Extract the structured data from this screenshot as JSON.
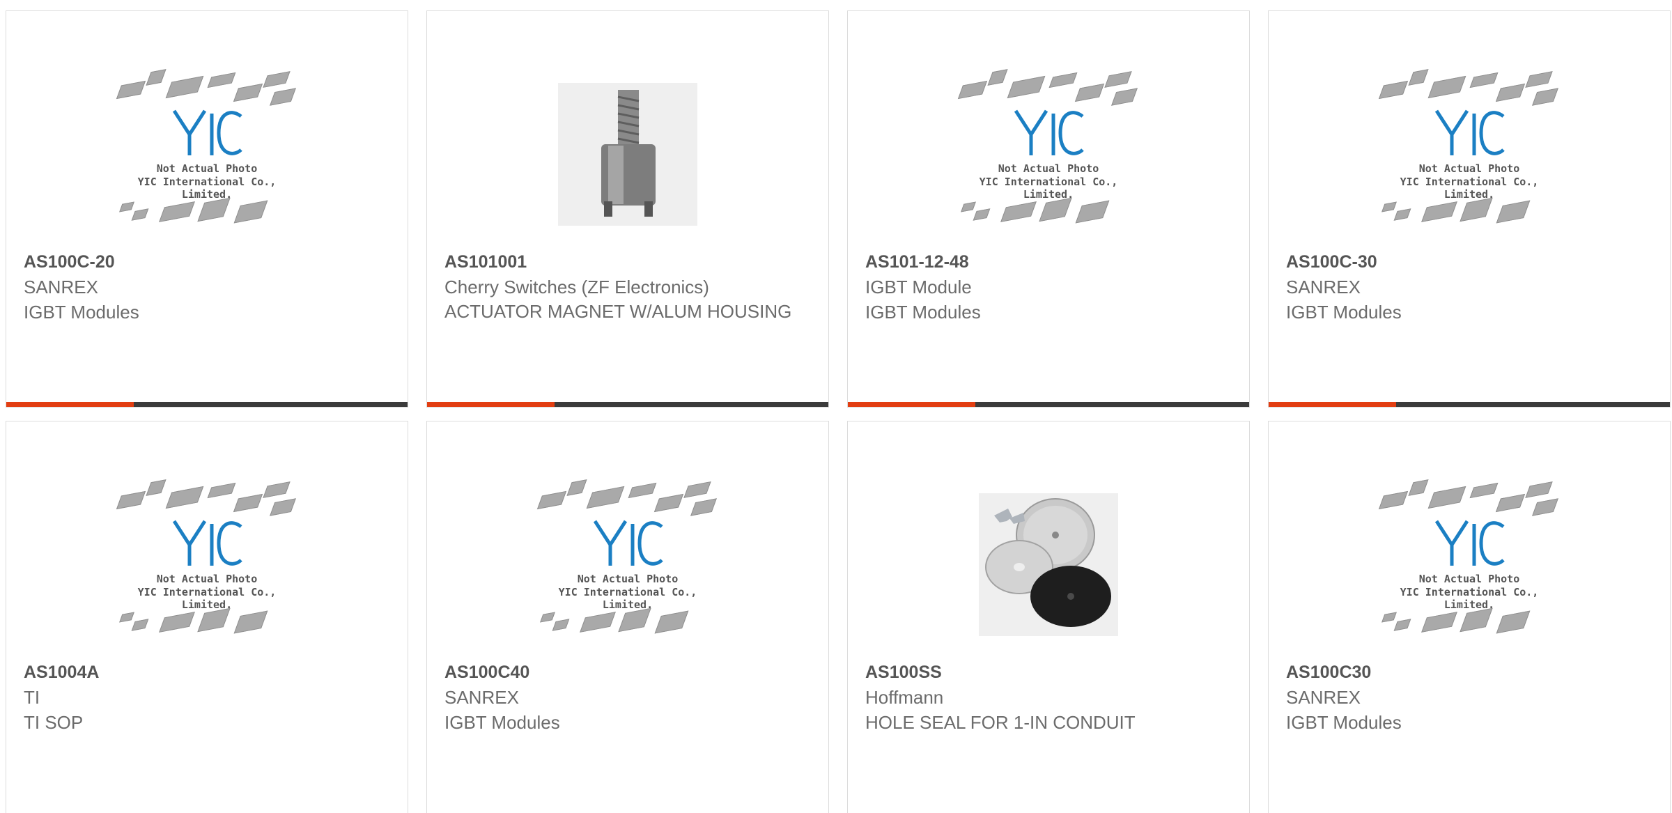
{
  "placeholder": {
    "line1": "Not Actual Photo",
    "line2": "YIC International Co., Limited.",
    "logo_text": "YIC"
  },
  "products": [
    {
      "part": "AS100C-20",
      "line1": "SANREX",
      "line2": "IGBT Modules",
      "image": "placeholder-icon"
    },
    {
      "part": "AS101001",
      "line1": "Cherry Switches (ZF Electronics)",
      "line2": "ACTUATOR MAGNET W/ALUM HOUSING",
      "image": "threaded-standoff-photo"
    },
    {
      "part": "AS101-12-48",
      "line1": "IGBT Module",
      "line2": "IGBT Modules",
      "image": "placeholder-icon"
    },
    {
      "part": "AS100C-30",
      "line1": "SANREX",
      "line2": "IGBT Modules",
      "image": "placeholder-icon"
    },
    {
      "part": "AS1004A",
      "line1": "TI",
      "line2": "TI SOP",
      "image": "placeholder-icon"
    },
    {
      "part": "AS100C40",
      "line1": "SANREX",
      "line2": "IGBT Modules",
      "image": "placeholder-icon"
    },
    {
      "part": "AS100SS",
      "line1": "Hoffmann",
      "line2": "HOLE SEAL FOR 1-IN CONDUIT",
      "image": "hole-seal-photo"
    },
    {
      "part": "AS100C30",
      "line1": "SANREX",
      "line2": "IGBT Modules",
      "image": "placeholder-icon"
    }
  ],
  "colors": {
    "accent": "#e23e12",
    "bar": "#3b3b3b",
    "logo_blue": "#1b7fc3"
  }
}
